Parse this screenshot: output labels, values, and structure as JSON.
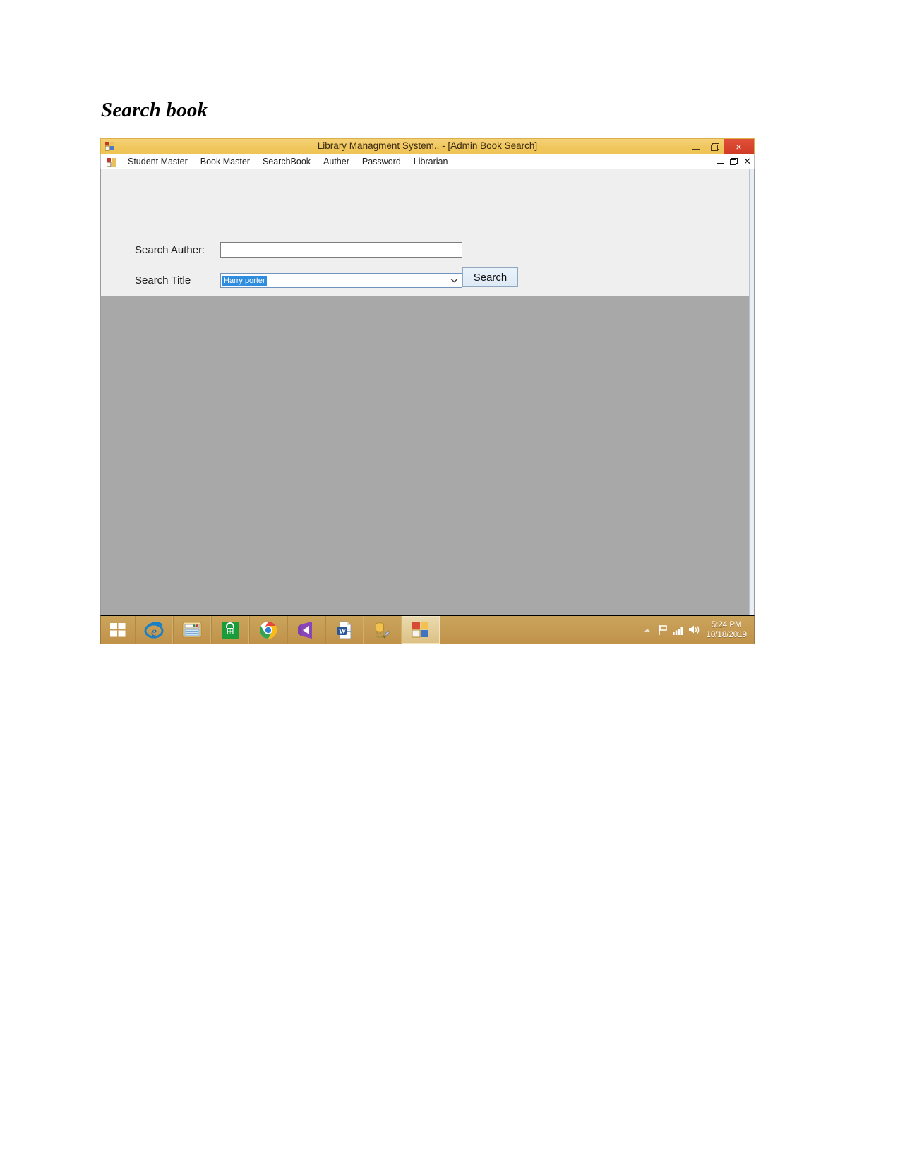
{
  "document": {
    "heading": "Search book"
  },
  "window": {
    "title": "Library Managment System.. - [Admin Book Search]",
    "app_icon": "vb-form-icon",
    "controls": {
      "minimize_label": "Minimize",
      "restore_label": "Restore",
      "close_label": "×"
    },
    "accent_titlebar": "#f0c75e",
    "accent_close": "#d9432b"
  },
  "menubar": {
    "icon": "mdi-child-icon",
    "items": [
      {
        "label": "Student Master"
      },
      {
        "label": "Book Master"
      },
      {
        "label": "SearchBook"
      },
      {
        "label": "Auther"
      },
      {
        "label": "Password"
      },
      {
        "label": "Librarian"
      }
    ],
    "mdi_controls": {
      "minimize_label": "_",
      "restore_label": "Restore",
      "close_label": "✕"
    }
  },
  "form": {
    "author": {
      "label": "Search Auther:",
      "value": "",
      "placeholder": ""
    },
    "title": {
      "label": "Search Title",
      "selected_value": "Harry porter",
      "options": [
        "Harry porter"
      ],
      "highlight_color": "#2f8de0"
    },
    "search_button": {
      "label": "Search"
    }
  },
  "taskbar": {
    "start": {
      "name": "start-button"
    },
    "items": [
      {
        "name": "internet-explorer-icon",
        "label": "Internet Explorer"
      },
      {
        "name": "file-explorer-icon",
        "label": "File Explorer"
      },
      {
        "name": "windows-store-icon",
        "label": "Store"
      },
      {
        "name": "google-chrome-icon",
        "label": "Google Chrome"
      },
      {
        "name": "visual-studio-icon",
        "label": "Visual Studio"
      },
      {
        "name": "microsoft-word-icon",
        "label": "Microsoft Word"
      },
      {
        "name": "sql-server-tools-icon",
        "label": "SQL Server Tools"
      },
      {
        "name": "vb-app-icon",
        "label": "Library Managment System",
        "active": true
      }
    ],
    "tray": [
      {
        "name": "show-hidden-icons-chevron"
      },
      {
        "name": "action-center-flag-icon"
      },
      {
        "name": "network-signal-icon"
      },
      {
        "name": "volume-speaker-icon"
      }
    ],
    "clock": {
      "time": "5:24 PM",
      "date": "10/18/2019"
    }
  }
}
